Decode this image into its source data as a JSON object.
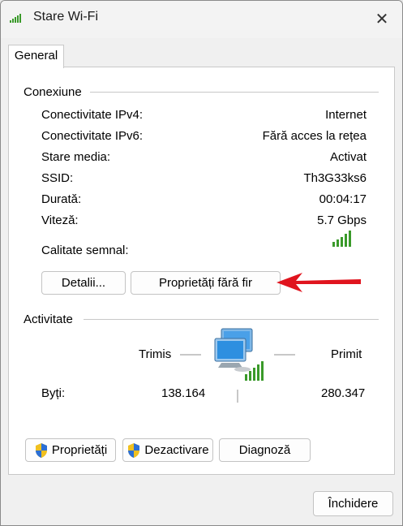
{
  "window": {
    "title": "Stare Wi-Fi",
    "close_glyph": "✕"
  },
  "tabs": [
    {
      "label": "General"
    }
  ],
  "connection": {
    "group_title": "Conexiune",
    "rows": [
      {
        "label": "Conectivitate IPv4:",
        "value": "Internet"
      },
      {
        "label": "Conectivitate IPv6:",
        "value": "Fără acces la rețea"
      },
      {
        "label": "Stare media:",
        "value": "Activat"
      },
      {
        "label": "SSID:",
        "value": "Th3G33ks6"
      },
      {
        "label": "Durată:",
        "value": "00:04:17"
      },
      {
        "label": "Viteză:",
        "value": "5.7 Gbps"
      }
    ],
    "signal_label": "Calitate semnal:",
    "signal_bars": 5,
    "details_button": "Detalii...",
    "wireless_props_button": "Proprietăți fără fir"
  },
  "activity": {
    "group_title": "Activitate",
    "sent_label": "Trimis",
    "received_label": "Primit",
    "bytes_label": "Byți:",
    "bytes_sent": "138.164",
    "bytes_received": "280.347"
  },
  "bottom_buttons": {
    "properties": "Proprietăți",
    "disable": "Dezactivare",
    "diagnose": "Diagnoză"
  },
  "close_button": "Închidere",
  "colors": {
    "arrow": "#e0141e",
    "signal": "#3a9a2a",
    "accent": "#0067c0"
  },
  "icons": [
    "wifi-signal-icon",
    "close-icon",
    "signal-bars-icon",
    "network-computers-icon",
    "uac-shield-icon"
  ]
}
